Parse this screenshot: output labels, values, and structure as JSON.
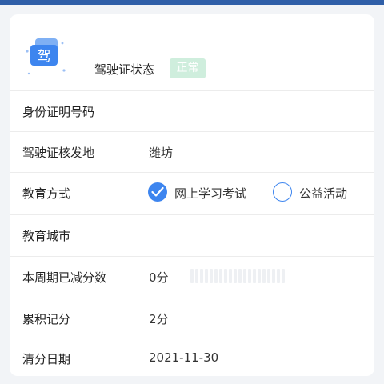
{
  "colors": {
    "accent": "#3d85ef",
    "top_bar": "#2f5fa8",
    "badge_bg": "#cfeedd"
  },
  "header": {
    "icon_char": "驾",
    "status_label": "驾驶证状态",
    "status_badge": "正常"
  },
  "rows": {
    "id_number": {
      "label": "身份证明号码",
      "value": ""
    },
    "issue_place": {
      "label": "驾驶证核发地",
      "value": "潍坊"
    },
    "education_method": {
      "label": "教育方式",
      "options": [
        {
          "label": "网上学习考试",
          "checked": true
        },
        {
          "label": "公益活动",
          "checked": false
        }
      ]
    },
    "education_city": {
      "label": "教育城市",
      "value": ""
    },
    "deducted_points": {
      "label": "本周期已减分数",
      "value": "0分"
    },
    "accumulated_points": {
      "label": "累积记分",
      "value": "2分"
    },
    "clear_date": {
      "label": "清分日期",
      "value": "2021-11-30"
    }
  }
}
